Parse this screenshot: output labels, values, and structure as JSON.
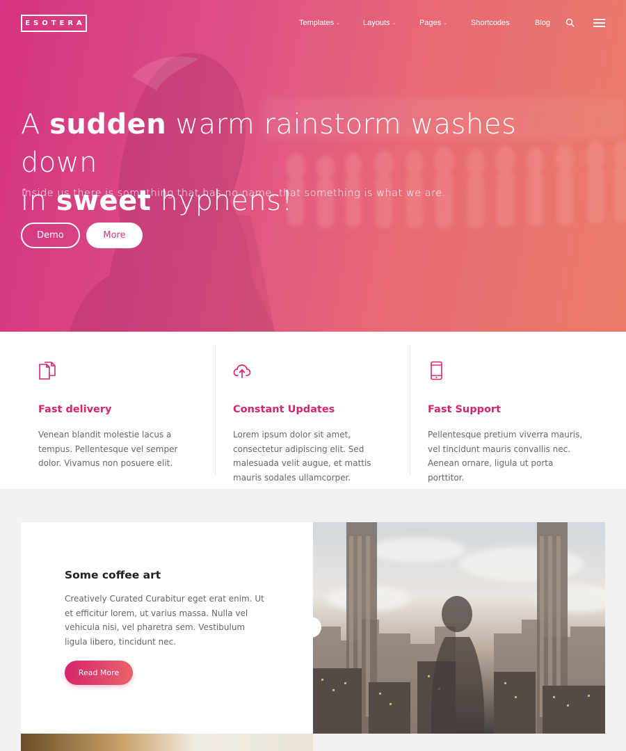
{
  "header": {
    "logo": "ESOTERA",
    "nav": [
      {
        "label": "Templates",
        "has_dropdown": true
      },
      {
        "label": "Layouts",
        "has_dropdown": true
      },
      {
        "label": "Pages",
        "has_dropdown": true
      },
      {
        "label": "Shortcodes",
        "has_dropdown": false
      },
      {
        "label": "Blog",
        "has_dropdown": false
      }
    ],
    "dropdown_glyph": "⌄",
    "search_icon": "search-icon",
    "menu_icon": "hamburger-menu-icon"
  },
  "hero": {
    "title_part1": "A ",
    "title_bold1": "sudden",
    "title_part2": " warm rainstorm washes down",
    "title_part3": "in ",
    "title_bold2": "sweet",
    "title_part4": " hyphens!",
    "subtitle": "Inside us there is something that has no name, that something is what we are.",
    "btn_demo": "Demo",
    "btn_more": "More",
    "gradient_colors": [
      "#d3347f",
      "#ea7b68"
    ]
  },
  "features": [
    {
      "icon": "documents-icon",
      "title": "Fast delivery",
      "text": "Venean blandit molestie lacus a tempus. Pellentesque vel semper dolor. Vivamus non posuere elit."
    },
    {
      "icon": "cloud-upload-icon",
      "title": "Constant Updates",
      "text": "Lorem ipsum dolor sit amet, consectetur adipiscing elit. Sed malesuada velit augue, et mattis mauris sodales ullamcorper."
    },
    {
      "icon": "mobile-phone-icon",
      "title": "Fast Support",
      "text": "Pellentesque pretium viverra mauris, vel tincidunt mauris convallis nec. Aenean ornare, ligula ut porta porttitor."
    }
  ],
  "post": {
    "title": "Some coffee art",
    "text": "Creatively Curated Curabitur eget erat enim. Ut et efficitur lorem, ut varius massa. Nulla vel vehicula nisi, vel pharetra sem. Vestibulum ligula libero, tincidunt nec.",
    "button": "Read More"
  },
  "colors": {
    "accent": "#d7246e",
    "accent_end": "#e8636a",
    "section_bg": "#f3f1ef"
  }
}
